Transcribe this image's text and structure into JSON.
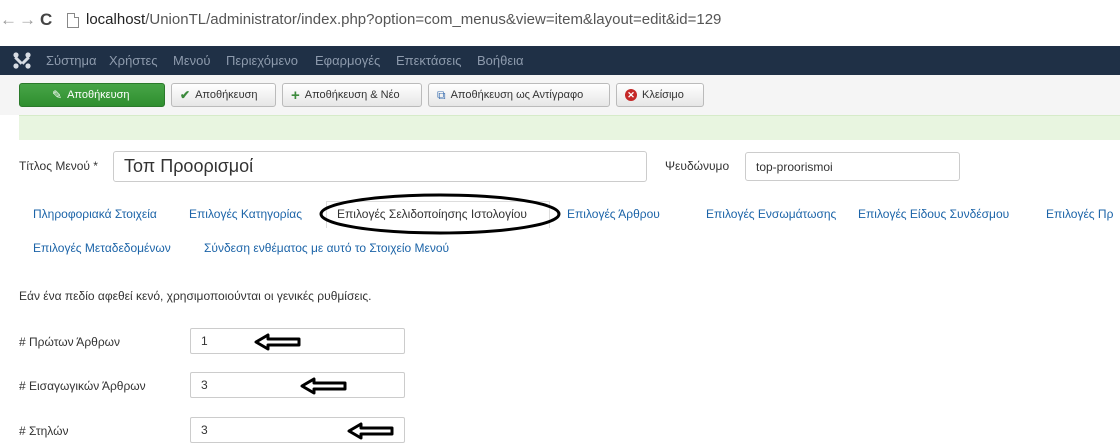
{
  "browser": {
    "back_glyph": "←",
    "forward_glyph": "→",
    "reload_glyph": "C",
    "url_host": "localhost",
    "url_path": "/UnionTL/administrator/index.php?option=com_menus&view=item&layout=edit&id=129"
  },
  "navbar": {
    "items": [
      "Σύστημα",
      "Χρήστες",
      "Μενού",
      "Περιεχόμενο",
      "Εφαρμογές",
      "Επεκτάσεις",
      "Βοήθεια"
    ]
  },
  "toolbar": {
    "save_label": "Αποθήκευση",
    "save_close_label": "Αποθήκευση",
    "save_new_label": "Αποθήκευση & Νέο",
    "save_copy_label": "Αποθήκευση ως Αντίγραφο",
    "close_label": "Κλείσιμο"
  },
  "form": {
    "title_label": "Τίτλος Μενού *",
    "title_value": "Τοπ Προορισμοί",
    "alias_label": "Ψευδώνυμο",
    "alias_value": "top-proorismoi"
  },
  "tabs": {
    "row1": [
      "Πληροφοριακά Στοιχεία",
      "Επιλογές Κατηγορίας",
      "Επιλογές Σελιδοποίησης Ιστολογίου",
      "Επιλογές Άρθρου",
      "Επιλογές Ενσωμάτωσης",
      "Επιλογές Είδους Συνδέσμου",
      "Επιλογές Πρ"
    ],
    "row2": [
      "Επιλογές Μεταδεδομένων",
      "Σύνδεση ενθέματος με αυτό το Στοιχείο Μενού"
    ],
    "active_index": 2
  },
  "content": {
    "note": "Εάν ένα πεδίο αφεθεί κενό, χρησιμοποιούνται οι γενικές ρυθμίσεις.",
    "fields": [
      {
        "label": "# Πρώτων Άρθρων",
        "value": "1"
      },
      {
        "label": "# Εισαγωγικών Άρθρων",
        "value": "3"
      },
      {
        "label": "# Στηλών",
        "value": "3"
      }
    ]
  },
  "colors": {
    "navbar_bg": "#1f3046",
    "save_green": "#3c9a3c",
    "link_blue": "#1c64a8",
    "close_red": "#c52827"
  },
  "icons": {
    "save": "edit-icon",
    "save_close": "check-icon",
    "save_new": "plus-icon",
    "save_copy": "copy-icon",
    "close": "close-circle-icon"
  }
}
